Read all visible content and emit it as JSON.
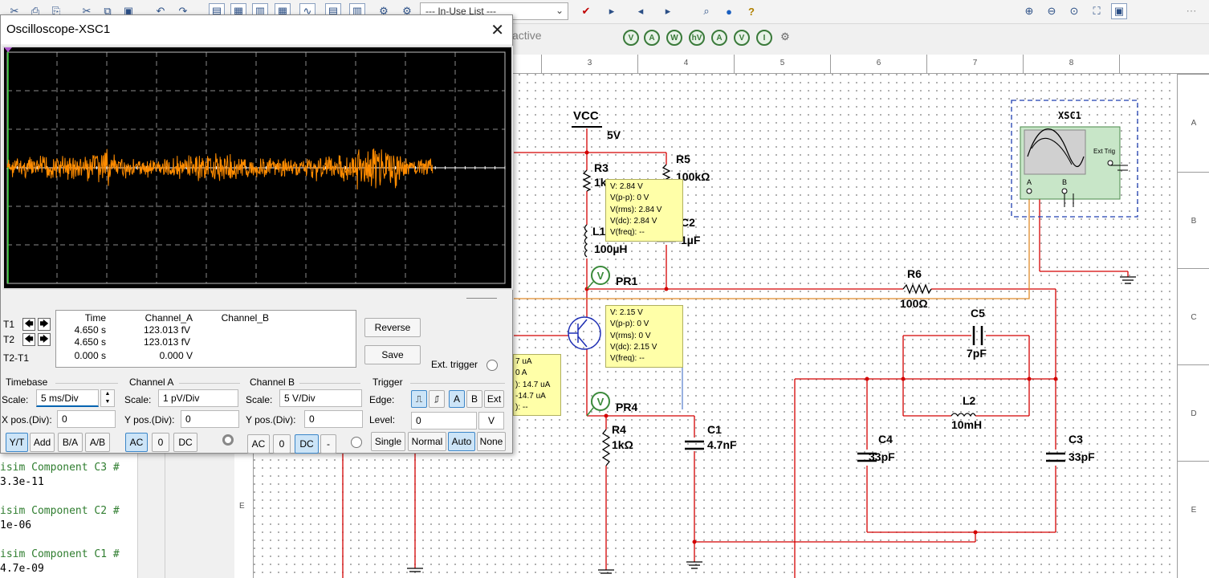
{
  "toolbar": {
    "inuse_list": "--- In-Use List ---",
    "active_label": "active",
    "meter_buttons": [
      "V",
      "A",
      "W",
      "hV",
      "A",
      "V",
      "I"
    ]
  },
  "ruler": {
    "columns": [
      "3",
      "4",
      "5",
      "6",
      "7",
      "8"
    ],
    "rows": [
      "A",
      "B",
      "C",
      "D",
      "E"
    ]
  },
  "schematic": {
    "vcc_label": "VCC",
    "vcc_value": "5V",
    "r3_label": "R3",
    "r3_value": "1k",
    "r5_label": "R5",
    "r5_value": "100kΩ",
    "l1_label": "L1",
    "l1_value": "100µH",
    "c2_label": "C2",
    "c2_value": "1µF",
    "pr1_label": "PR1",
    "pr4_label": "PR4",
    "r6_label": "R6",
    "r6_value": "100Ω",
    "c5_label": "C5",
    "c5_value": "7pF",
    "l2_label": "L2",
    "l2_value": "10mH",
    "c4_label": "C4",
    "c4_value": "33pF",
    "c3_label": "C3",
    "c3_value": "33pF",
    "r4_label": "R4",
    "r4_value": "1kΩ",
    "c1_label": "C1",
    "c1_value": "4.7nF",
    "xsc_label": "XSC1",
    "ext_trig": "Ext Trig",
    "chan_a": "A",
    "chan_b": "B",
    "probe_pr1": [
      "V: 2.84 V",
      "V(p-p): 0 V",
      "V(rms): 2.84 V",
      "V(dc): 2.84 V",
      "V(freq): --"
    ],
    "probe_pr4": [
      "V: 2.15 V",
      "V(p-p): 0 V",
      "V(rms): 0 V",
      "V(dc): 2.15 V",
      "V(freq): --"
    ],
    "probe_partial": [
      "7 uA",
      "0 A",
      "): 14.7 uA",
      "-14.7 uA",
      "): --"
    ]
  },
  "spice": {
    "lines": [
      {
        "text": "isim Component C3 #",
        "comment": true
      },
      {
        "text": "3.3e-11",
        "comment": false
      },
      {
        "text": "isim Component C2 #",
        "comment": true
      },
      {
        "text": "1e-06",
        "comment": false
      },
      {
        "text": "isim Component C1 #",
        "comment": true
      },
      {
        "text": "4.7e-09",
        "comment": false
      }
    ]
  },
  "oscilloscope": {
    "title": "Oscilloscope-XSC1",
    "trace_color": "#ff8c00",
    "headers": {
      "time": "Time",
      "channel_a": "Channel_A",
      "channel_b": "Channel_B"
    },
    "rows": [
      {
        "label": "T1",
        "time": "4.650 s",
        "channel_a": "123.013 fV",
        "channel_b": ""
      },
      {
        "label": "T2",
        "time": "4.650 s",
        "channel_a": "123.013 fV",
        "channel_b": ""
      },
      {
        "label": "T2-T1",
        "time": "0.000 s",
        "channel_a": "0.000 V",
        "channel_b": ""
      }
    ],
    "reverse_label": "Reverse",
    "save_label": "Save",
    "ext_trigger_label": "Ext. trigger",
    "timebase": {
      "title": "Timebase",
      "scale_label": "Scale:",
      "scale_value": "5 ms/Div",
      "xpos_label": "X pos.(Div):",
      "xpos_value": "0",
      "buttons": [
        "Y/T",
        "Add",
        "B/A",
        "A/B"
      ]
    },
    "channel_a": {
      "title": "Channel A",
      "scale_label": "Scale:",
      "scale_value": "1 pV/Div",
      "ypos_label": "Y pos.(Div):",
      "ypos_value": "0",
      "buttons": [
        "AC",
        "0",
        "DC"
      ]
    },
    "channel_b": {
      "title": "Channel B",
      "scale_label": "Scale:",
      "scale_value": "5  V/Div",
      "ypos_label": "Y pos.(Div):",
      "ypos_value": "0",
      "buttons": [
        "AC",
        "0",
        "DC",
        "-"
      ]
    },
    "trigger": {
      "title": "Trigger",
      "edge_label": "Edge:",
      "edge_buttons": [
        "A",
        "B",
        "Ext"
      ],
      "level_label": "Level:",
      "level_value": "0",
      "level_unit": "V",
      "mode_buttons": [
        "Single",
        "Normal",
        "Auto",
        "None"
      ]
    }
  }
}
